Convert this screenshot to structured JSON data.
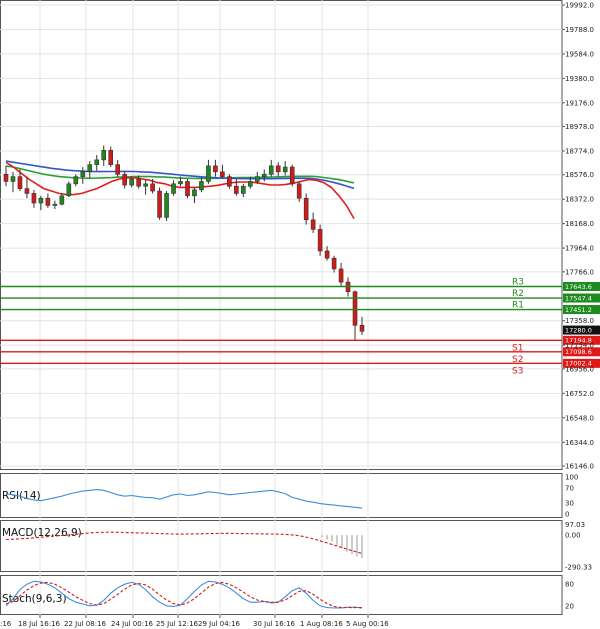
{
  "chart_data": {
    "type": "candlestick",
    "price_axis": {
      "ticks": [
        "19992.0",
        "19788.0",
        "19584.0",
        "19380.0",
        "19176.0",
        "18978.0",
        "18774.0",
        "18576.0",
        "18372.0",
        "18168.0",
        "17964.0",
        "17766.0",
        "17358.0",
        "17154.0",
        "16956.0",
        "16752.0",
        "16548.0",
        "16344.0",
        "16146.0"
      ],
      "ylim": [
        16146,
        19992
      ]
    },
    "time_axis": {
      "ticks": [
        "18 Jul 16:16",
        "22 Jul 08:16",
        "24 Jul 00:16",
        "25 Jul 12:16",
        "29 Jul 04:16",
        "30 Jul 16:16",
        "1 Aug 08:16",
        "5 Aug 00:16"
      ],
      "first_tick_partial": ":16"
    },
    "candles": [
      [
        18580,
        18650,
        18480,
        18520
      ],
      [
        18520,
        18600,
        18430,
        18560
      ],
      [
        18560,
        18620,
        18440,
        18460
      ],
      [
        18460,
        18560,
        18380,
        18420
      ],
      [
        18420,
        18450,
        18300,
        18340
      ],
      [
        18340,
        18400,
        18280,
        18380
      ],
      [
        18380,
        18420,
        18300,
        18320
      ],
      [
        18320,
        18360,
        18290,
        18330
      ],
      [
        18330,
        18420,
        18320,
        18400
      ],
      [
        18400,
        18520,
        18390,
        18500
      ],
      [
        18500,
        18580,
        18480,
        18560
      ],
      [
        18560,
        18640,
        18500,
        18600
      ],
      [
        18600,
        18690,
        18550,
        18660
      ],
      [
        18660,
        18740,
        18610,
        18700
      ],
      [
        18700,
        18820,
        18650,
        18780
      ],
      [
        18780,
        18810,
        18640,
        18660
      ],
      [
        18660,
        18700,
        18560,
        18580
      ],
      [
        18580,
        18600,
        18460,
        18490
      ],
      [
        18490,
        18560,
        18470,
        18540
      ],
      [
        18540,
        18570,
        18460,
        18480
      ],
      [
        18480,
        18530,
        18410,
        18500
      ],
      [
        18500,
        18540,
        18420,
        18440
      ],
      [
        18440,
        18470,
        18200,
        18220
      ],
      [
        18220,
        18440,
        18190,
        18420
      ],
      [
        18420,
        18530,
        18400,
        18500
      ],
      [
        18500,
        18560,
        18480,
        18520
      ],
      [
        18520,
        18540,
        18380,
        18400
      ],
      [
        18400,
        18470,
        18340,
        18450
      ],
      [
        18450,
        18550,
        18430,
        18520
      ],
      [
        18520,
        18700,
        18500,
        18650
      ],
      [
        18650,
        18700,
        18560,
        18600
      ],
      [
        18600,
        18660,
        18540,
        18560
      ],
      [
        18560,
        18580,
        18460,
        18480
      ],
      [
        18480,
        18540,
        18400,
        18420
      ],
      [
        18420,
        18500,
        18390,
        18480
      ],
      [
        18480,
        18560,
        18460,
        18520
      ],
      [
        18520,
        18600,
        18500,
        18560
      ],
      [
        18560,
        18620,
        18520,
        18580
      ],
      [
        18580,
        18700,
        18560,
        18650
      ],
      [
        18650,
        18680,
        18560,
        18600
      ],
      [
        18600,
        18690,
        18570,
        18640
      ],
      [
        18640,
        18660,
        18480,
        18500
      ],
      [
        18500,
        18520,
        18350,
        18380
      ],
      [
        18380,
        18420,
        18160,
        18200
      ],
      [
        18200,
        18260,
        18090,
        18120
      ],
      [
        18120,
        18160,
        17900,
        17940
      ],
      [
        17940,
        17980,
        17860,
        17880
      ],
      [
        17880,
        17900,
        17760,
        17790
      ],
      [
        17790,
        17840,
        17640,
        17680
      ],
      [
        17680,
        17720,
        17560,
        17600
      ],
      [
        17600,
        17610,
        17190,
        17320
      ],
      [
        17320,
        17390,
        17240,
        17270
      ]
    ],
    "moving_averages": [
      {
        "color": "#2e9e3a",
        "values": [
          18650,
          18640,
          18625,
          18610,
          18595,
          18580,
          18570,
          18560,
          18555,
          18550,
          18548,
          18547,
          18548,
          18550,
          18552,
          18556,
          18558,
          18560,
          18560,
          18560,
          18558,
          18556,
          18552,
          18548,
          18546,
          18545,
          18545,
          18545,
          18546,
          18548,
          18550,
          18552,
          18553,
          18554,
          18555,
          18556,
          18558,
          18560,
          18562,
          18563,
          18563,
          18560,
          18553,
          18544,
          18535,
          18522,
          18508
        ]
      },
      {
        "color": "#3355cc",
        "values": [
          18690,
          18680,
          18670,
          18660,
          18650,
          18640,
          18630,
          18622,
          18615,
          18610,
          18606,
          18603,
          18602,
          18602,
          18603,
          18604,
          18604,
          18603,
          18600,
          18597,
          18592,
          18586,
          18580,
          18574,
          18568,
          18563,
          18558,
          18554,
          18550,
          18547,
          18545,
          18544,
          18543,
          18543,
          18543,
          18543,
          18544,
          18545,
          18546,
          18547,
          18546,
          18540,
          18530,
          18516,
          18500,
          18482,
          18462
        ]
      },
      {
        "color": "#e31d1d",
        "values": [
          18680,
          18640,
          18590,
          18540,
          18500,
          18460,
          18440,
          18420,
          18410,
          18410,
          18420,
          18440,
          18460,
          18490,
          18520,
          18540,
          18550,
          18550,
          18540,
          18530,
          18510,
          18500,
          18480,
          18470,
          18470,
          18470,
          18475,
          18480,
          18488,
          18500,
          18510,
          18515,
          18515,
          18510,
          18500,
          18490,
          18490,
          18495,
          18505,
          18520,
          18535,
          18530,
          18510,
          18470,
          18400,
          18320,
          18210
        ]
      }
    ],
    "levels": [
      {
        "name": "R3",
        "value": 17643.6,
        "label": "17643.6",
        "color": "#1f8a1f"
      },
      {
        "name": "R2",
        "value": 17547.4,
        "label": "17547.4",
        "color": "#1f8a1f"
      },
      {
        "name": "R1",
        "value": 17451.2,
        "label": "17451.2",
        "color": "#1f8a1f"
      },
      {
        "name": "S1",
        "value": 17194.8,
        "label": "17194.8",
        "color": "#e01818"
      },
      {
        "name": "S2",
        "value": 17098.6,
        "label": "17098.6",
        "color": "#e01818"
      },
      {
        "name": "S3",
        "value": 17002.4,
        "label": "17002.4",
        "color": "#e01818"
      }
    ],
    "current_price": {
      "value": 17280.0,
      "label": "17280.0"
    },
    "rsi": {
      "label": "RSI(14)",
      "ticks": [
        "100",
        "70",
        "30",
        "0"
      ],
      "ylim": [
        0,
        100
      ],
      "values": [
        55,
        52,
        48,
        42,
        38,
        36,
        40,
        44,
        48,
        54,
        58,
        62,
        64,
        66,
        64,
        58,
        52,
        48,
        50,
        47,
        45,
        44,
        40,
        46,
        52,
        54,
        50,
        52,
        56,
        60,
        58,
        55,
        52,
        54,
        56,
        58,
        60,
        62,
        64,
        60,
        55,
        45,
        40,
        35,
        32,
        28,
        26,
        24,
        22,
        20,
        18,
        16
      ]
    },
    "macd": {
      "label": "MACD(12,26,9)",
      "ticks": [
        "97.03",
        "0.00",
        "-290.33"
      ],
      "ylim": [
        -320,
        120
      ],
      "histogram": [
        -20,
        -40,
        -60,
        -90,
        -120,
        -150,
        -175,
        -195,
        -210
      ],
      "signal": [
        -40,
        -38,
        -34,
        -30,
        -26,
        -20,
        -14,
        -8,
        -4,
        2,
        8,
        14,
        20,
        24,
        26,
        27,
        26,
        24,
        22,
        20,
        18,
        16,
        14,
        12,
        10,
        9,
        10,
        11,
        12,
        14,
        15,
        16,
        16,
        15,
        14,
        13,
        12,
        11,
        10,
        8,
        6,
        2,
        -6,
        -18,
        -34,
        -52,
        -72,
        -92,
        -112,
        -132,
        -150,
        -168
      ]
    },
    "stoch": {
      "label": "Stoch(9,6,3)",
      "ticks": [
        "80",
        "20"
      ],
      "ylim": [
        0,
        100
      ],
      "k": [
        20,
        40,
        65,
        80,
        88,
        86,
        80,
        70,
        55,
        40,
        30,
        25,
        20,
        22,
        35,
        55,
        70,
        80,
        85,
        80,
        65,
        45,
        30,
        20,
        18,
        22,
        40,
        60,
        78,
        88,
        86,
        80,
        70,
        55,
        40,
        30,
        30,
        32,
        28,
        30,
        45,
        62,
        70,
        55,
        35,
        20,
        15,
        14,
        14,
        16,
        16,
        14
      ],
      "d": [
        25,
        32,
        48,
        64,
        76,
        83,
        85,
        80,
        70,
        58,
        45,
        35,
        26,
        22,
        26,
        38,
        52,
        66,
        78,
        82,
        78,
        66,
        50,
        36,
        26,
        22,
        28,
        40,
        56,
        72,
        82,
        85,
        80,
        70,
        58,
        45,
        36,
        32,
        30,
        30,
        36,
        48,
        60,
        62,
        52,
        38,
        26,
        18,
        15,
        15,
        15,
        15
      ]
    }
  }
}
